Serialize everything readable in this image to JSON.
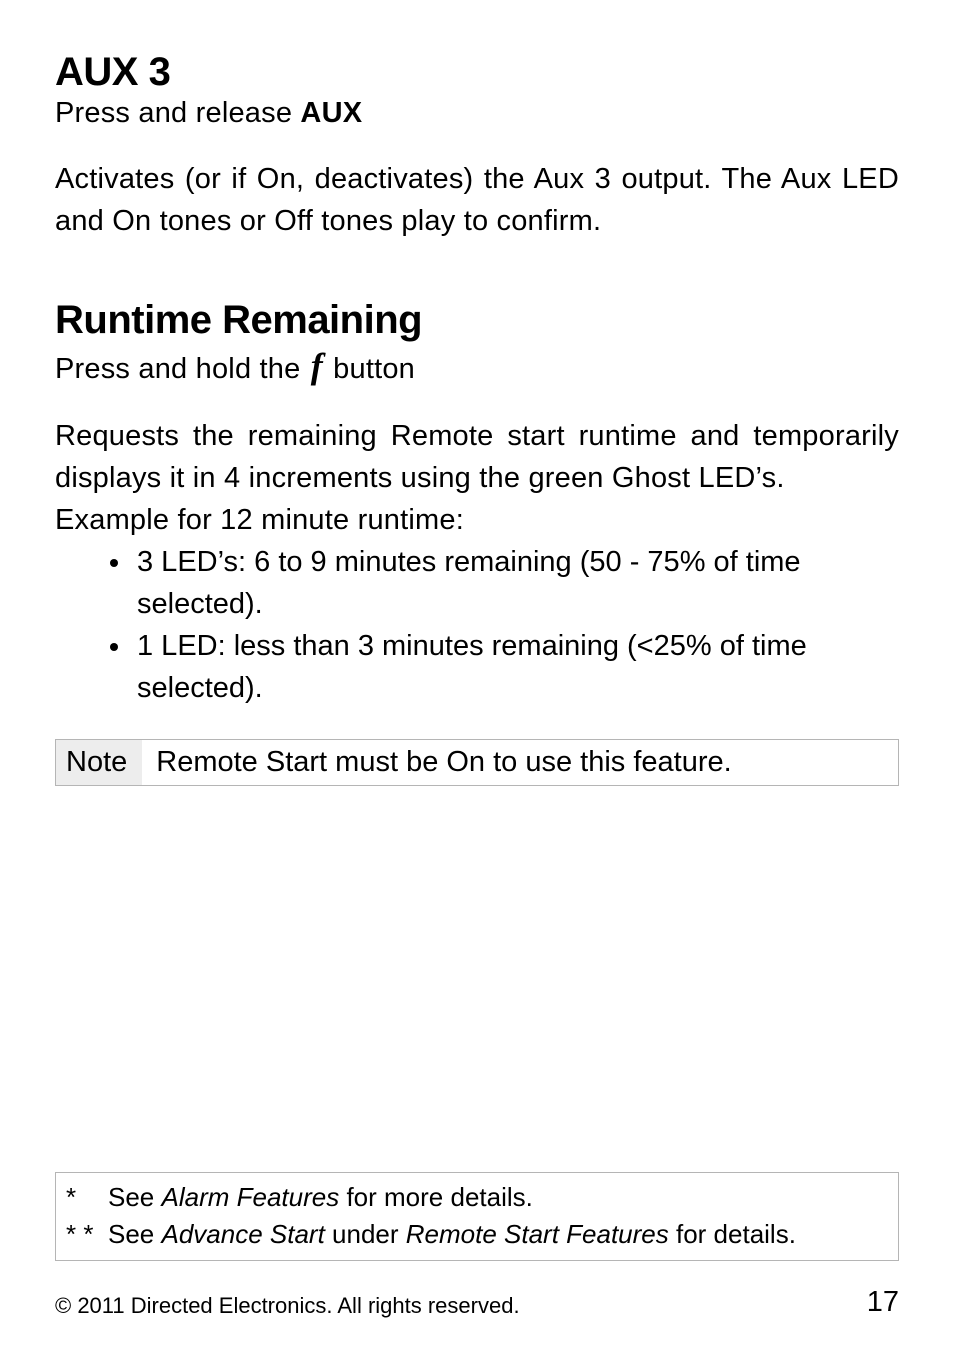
{
  "section_aux3": {
    "heading": "AUX 3",
    "instr_press": "Press",
    "instr_mid": " and release ",
    "instr_aux": "AUX",
    "body": "Activates (or if On, deactivates) the Aux 3 output. The Aux LED and On tones or Off tones play to confirm."
  },
  "section_runtime": {
    "heading": "Runtime Remaining",
    "instr_press": "Press",
    "instr_mid1": " and ",
    "instr_hold": "hold",
    "instr_mid2": " the ",
    "instr_f": "f",
    "instr_end": " button",
    "body_part1": "Requests the remaining Remote start runtime and temporarily displays it in 4 increments using the green Ghost LED’s.",
    "body_part2": "Example for 12 minute runtime:",
    "bullets": [
      "3 LED’s: 6 to 9 minutes remaining (50 - 75% of time selected).",
      "1 LED: less than 3 minutes remaining (<25% of time selected)."
    ],
    "note_label": "Note",
    "note_text": "Remote Start must be On to use this feature."
  },
  "footnotes": {
    "line1_star": "*",
    "line1_a": "See ",
    "line1_em": "Alarm Features",
    "line1_b": " for more details.",
    "line2_star": "* *",
    "line2_a": "See ",
    "line2_em1": "Advance Start",
    "line2_b": " under ",
    "line2_em2": "Remote Start Features",
    "line2_c": " for details."
  },
  "footer": {
    "copyright": "© 2011 Directed Electronics. All rights reserved.",
    "page": "17"
  }
}
